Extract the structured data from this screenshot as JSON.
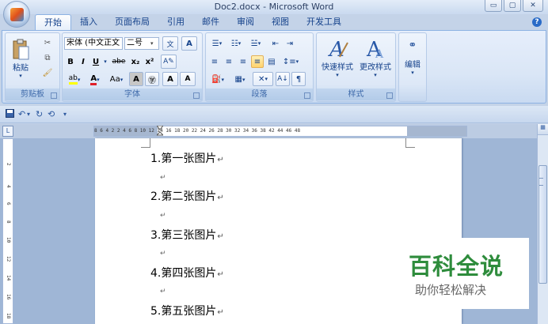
{
  "window": {
    "title": "Doc2.docx - Microsoft Word",
    "minimize": "▭",
    "maximize": "▢",
    "close": "✕"
  },
  "tabs": [
    {
      "label": "开始",
      "active": true
    },
    {
      "label": "插入"
    },
    {
      "label": "页面布局"
    },
    {
      "label": "引用"
    },
    {
      "label": "邮件"
    },
    {
      "label": "审阅"
    },
    {
      "label": "视图"
    },
    {
      "label": "开发工具"
    }
  ],
  "ribbon": {
    "clipboard": {
      "paste_label": "粘贴",
      "group_label": "剪贴板"
    },
    "font": {
      "font_name": "宋体 (中文正文",
      "font_size": "二号",
      "bold": "B",
      "italic": "I",
      "underline": "U",
      "strike": "abe",
      "subscript": "x₂",
      "superscript": "x²",
      "change_case": "Aa",
      "grow_font": "A",
      "shrink_font": "A",
      "group_label": "字体"
    },
    "paragraph": {
      "group_label": "段落"
    },
    "styles": {
      "quick_styles_label": "快速样式",
      "change_styles_label": "更改样式",
      "group_label": "样式"
    },
    "editing": {
      "label": "编辑"
    }
  },
  "qat": {
    "save": "💾",
    "undo": "↶",
    "redo": "↻",
    "more": "▾"
  },
  "ruler": {
    "tab_selector": "L",
    "numbers": "8  6  4  2     2   4  6  8  10  12  14  16  18  20  22  24  26  28  30  32  34  36  38     42  44  46  48"
  },
  "document": {
    "paragraphs": [
      "1.第一张图片",
      "2.第二张图片",
      "3.第三张图片",
      "4.第四张图片",
      "5.第五张图片"
    ],
    "paragraph_mark": "↵"
  },
  "watermark": {
    "title": "百科全说",
    "subtitle": "助你轻松解决"
  }
}
